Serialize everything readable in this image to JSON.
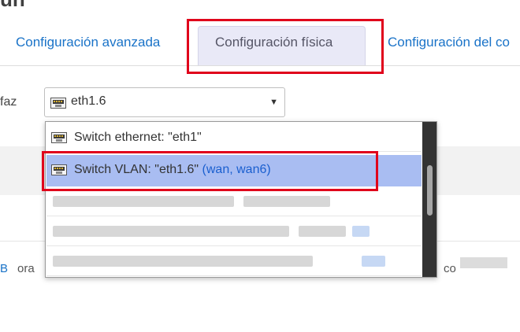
{
  "page": {
    "title": "un"
  },
  "tabs": [
    {
      "label": "Configuración avanzada",
      "active": false
    },
    {
      "label": "Configuración física",
      "active": true
    },
    {
      "label": "Configuración del co",
      "active": false
    }
  ],
  "interface_field": {
    "label": "faz",
    "selected_value": "eth1.6",
    "selected_icon": "network-port-icon"
  },
  "dropdown": {
    "items": [
      {
        "label": "Switch ethernet: \"eth1\"",
        "icon": "network-port-icon",
        "highlighted": false
      },
      {
        "label_prefix": "Switch VLAN: \"eth1.6\" ",
        "label_networks": "(wan, wan6)",
        "icon": "network-port-icon",
        "highlighted": true
      }
    ]
  },
  "bottom": {
    "left_fragment": "B",
    "mid_fragment": "ora",
    "right_fragment": "co"
  },
  "colors": {
    "link_blue": "#1a73c8",
    "annotation_red": "#e0001b",
    "selected_row": "#a9bdf2",
    "active_tab_bg": "#e9e9f7"
  }
}
